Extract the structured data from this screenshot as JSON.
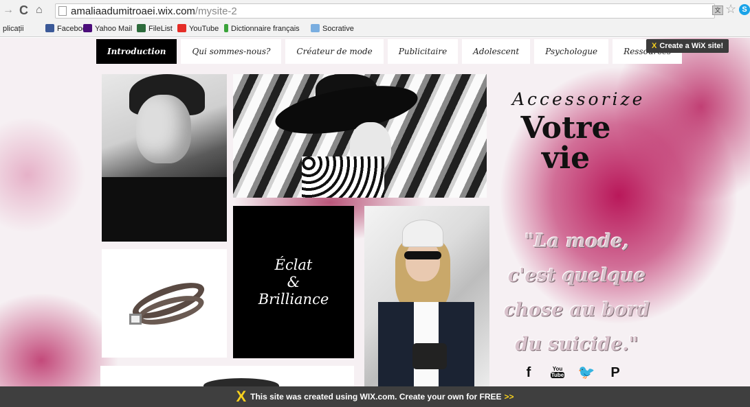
{
  "browser": {
    "url_domain": "amaliaadumitroaei.wix.com",
    "url_path": "/mysite-2",
    "back_glyph": "→",
    "reload_glyph": "C",
    "home_glyph": "⌂",
    "star_glyph": "☆",
    "translate_glyph": "文",
    "skype_glyph": "S"
  },
  "bookmarks": [
    {
      "label": "plicații",
      "icon": "apps-icon",
      "color": ""
    },
    {
      "label": "Facebook",
      "icon": "facebook-icon",
      "color": "#3b5998"
    },
    {
      "label": "Yahoo Mail",
      "icon": "yahoo-mail-icon",
      "color": "#4b0d7a"
    },
    {
      "label": "FileList",
      "icon": "filelist-icon",
      "color": "#2d6b3c"
    },
    {
      "label": "YouTube",
      "icon": "youtube-icon",
      "color": "#e52d27"
    },
    {
      "label": "Dictionnaire français",
      "icon": "dictionnaire-icon",
      "color": "#3aa33a"
    },
    {
      "label": "Socrative",
      "icon": "socrative-icon",
      "color": "#7aaee0"
    }
  ],
  "site": {
    "nav": [
      {
        "label": "Introduction",
        "active": true
      },
      {
        "label": "Qui sommes-nous?",
        "active": false
      },
      {
        "label": "Créateur de mode",
        "active": false
      },
      {
        "label": "Publicitaire",
        "active": false
      },
      {
        "label": "Adolescent",
        "active": false
      },
      {
        "label": "Psychologue",
        "active": false
      },
      {
        "label": "Ressources",
        "active": false
      }
    ],
    "create_wix_label": "Create a WiX site!",
    "eclat_lines": [
      "Éclat",
      "&",
      "Brilliance"
    ],
    "tagline": "Accessorize",
    "headline": "Votre vie",
    "quote": "\"La mode, c'est quelque chose au bord du suicide.\"",
    "social": {
      "facebook": "f",
      "youtube_top": "You",
      "youtube_bottom": "Tube",
      "twitter": "🐦",
      "pinterest": "P"
    },
    "accent_color": "#b9185a"
  },
  "banner": {
    "text": "This site was created using WIX.com. Create your own for FREE",
    "arrows": ">>",
    "logo_glyph": "X"
  }
}
